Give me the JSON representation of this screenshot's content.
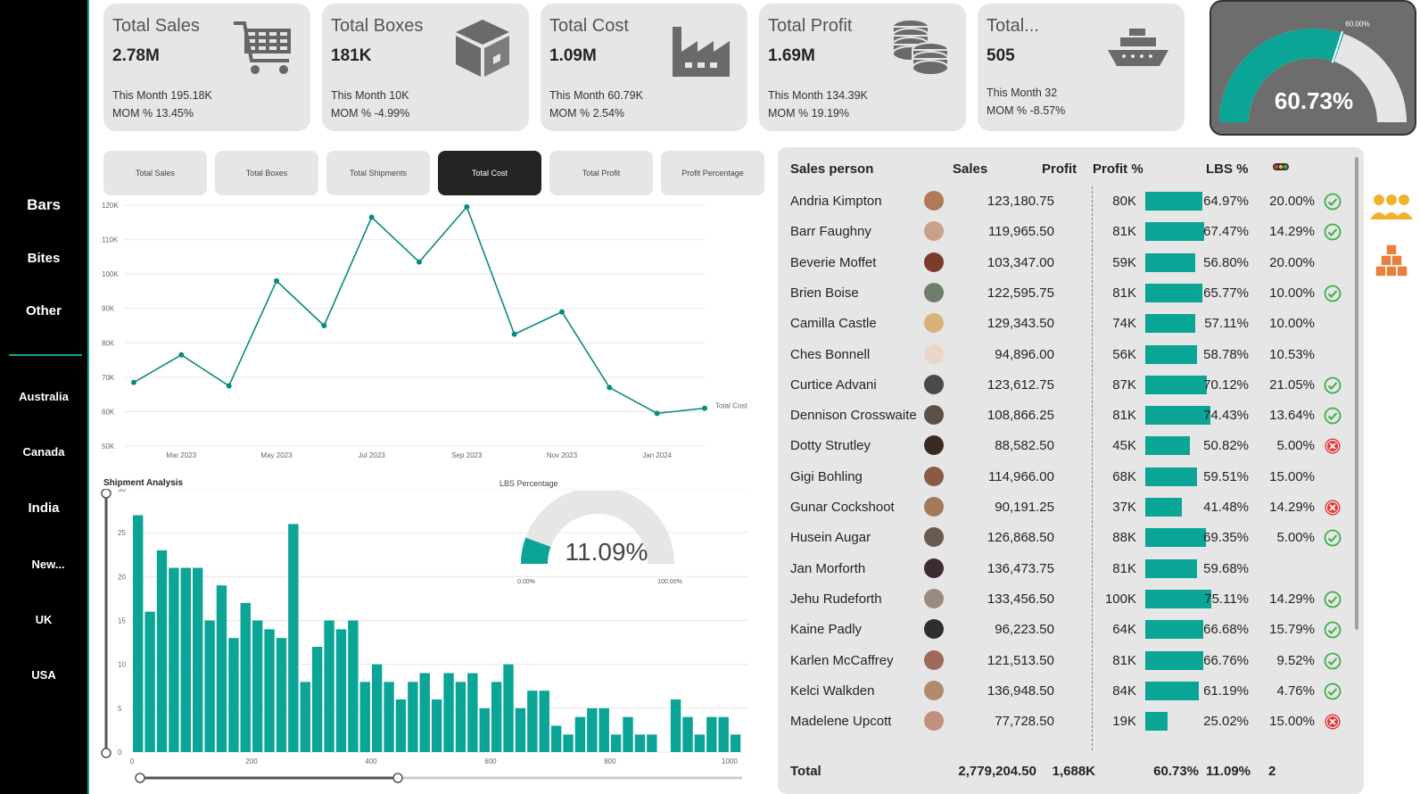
{
  "sidebar": {
    "categories": [
      "Bars",
      "Bites",
      "Other"
    ],
    "countries": [
      "Australia",
      "Canada",
      "India",
      "New...",
      "UK",
      "USA"
    ]
  },
  "cards": [
    {
      "title": "Total Sales",
      "value": "2.78M",
      "this_month": "This Month 195.18K",
      "mom": "MOM % 13.45%",
      "icon": "shopping-cart-icon"
    },
    {
      "title": "Total Boxes",
      "value": "181K",
      "this_month": "This Month 10K",
      "mom": "MOM % -4.99%",
      "icon": "box-icon"
    },
    {
      "title": "Total Cost",
      "value": "1.09M",
      "this_month": "This Month 60.79K",
      "mom": "MOM % 2.54%",
      "icon": "factory-icon"
    },
    {
      "title": "Total Profit",
      "value": "1.69M",
      "this_month": "This Month 134.39K",
      "mom": "MOM % 19.19%",
      "icon": "coins-icon"
    },
    {
      "title": "Total...",
      "value": "505",
      "this_month": "This Month 32",
      "mom": "MOM % -8.57%",
      "icon": "ship-icon"
    }
  ],
  "profit_gauge": {
    "value": "60.73%",
    "fraction": 0.6073,
    "target_label": "60.00%",
    "target": 0.6
  },
  "tabs": [
    "Total Sales",
    "Total Boxes",
    "Total Shipments",
    "Total Cost",
    "Total Profit",
    "Profit Percentage"
  ],
  "active_tab": 3,
  "colors": {
    "accent": "#0aa596",
    "dark": "#252423",
    "card": "#e6e6e6",
    "positive": "#3fae49",
    "negative": "#e0393e",
    "people": "#f2b12c",
    "boxes": "#e8803b"
  },
  "chart_data": [
    {
      "type": "line",
      "x": [
        "Feb 2023",
        "Mar 2023",
        "Apr 2023",
        "May 2023",
        "Jun 2023",
        "Jul 2023",
        "Aug 2023",
        "Sep 2023",
        "Oct 2023",
        "Nov 2023",
        "Dec 2023",
        "Jan 2024",
        "Feb 2024"
      ],
      "x_tick_labels": [
        "Mar 2023",
        "May 2023",
        "Jul 2023",
        "Sep 2023",
        "Nov 2023",
        "Jan 2024"
      ],
      "series": [
        {
          "name": "Total Cost",
          "values": [
            68500,
            76500,
            67500,
            98000,
            85000,
            116500,
            103500,
            119500,
            82500,
            89000,
            67000,
            59500,
            61000
          ]
        }
      ],
      "y_ticks": [
        "50K",
        "60K",
        "70K",
        "80K",
        "90K",
        "100K",
        "110K",
        "120K"
      ],
      "ylim": [
        50000,
        120000
      ],
      "grid": true
    },
    {
      "type": "bar",
      "title": "Shipment Analysis",
      "x_ticks": [
        "0",
        "200",
        "400",
        "600",
        "800",
        "1000"
      ],
      "y_ticks": [
        "0",
        "5",
        "10",
        "15",
        "20",
        "25",
        "30"
      ],
      "xlim": [
        0,
        1030
      ],
      "ylim": [
        0,
        30
      ],
      "bin_width": 20,
      "values": [
        27,
        16,
        23,
        21,
        21,
        21,
        15,
        19,
        13,
        17,
        15,
        14,
        13,
        26,
        8,
        12,
        15,
        14,
        15,
        8,
        10,
        8,
        6,
        8,
        9,
        6,
        9,
        8,
        9,
        5,
        8,
        10,
        5,
        7,
        7,
        3,
        2,
        4,
        5,
        5,
        2,
        4,
        2,
        2,
        0,
        6,
        4,
        2,
        4,
        4,
        2
      ]
    },
    {
      "type": "gauge",
      "title": "LBS Percentage",
      "value": 0.1109,
      "value_label": "11.09%",
      "min_label": "0.00%",
      "max_label": "100.00%"
    }
  ],
  "table": {
    "headers": [
      "Sales person",
      "Sales",
      "Profit",
      "Profit %",
      "LBS %"
    ],
    "rows": [
      {
        "name": "Andria Kimpton",
        "sales": "123,180.75",
        "profit": "80K",
        "ppct": "64.97%",
        "pv": 64.97,
        "lbs": "20.00%",
        "status": "check",
        "avatar": "#b07a58"
      },
      {
        "name": "Barr Faughny",
        "sales": "119,965.50",
        "profit": "81K",
        "ppct": "67.47%",
        "pv": 67.47,
        "lbs": "14.29%",
        "status": "check",
        "avatar": "#c9a08a"
      },
      {
        "name": "Beverie Moffet",
        "sales": "103,347.00",
        "profit": "59K",
        "ppct": "56.80%",
        "pv": 56.8,
        "lbs": "20.00%",
        "status": "",
        "avatar": "#7a3d2a"
      },
      {
        "name": "Brien Boise",
        "sales": "122,595.75",
        "profit": "81K",
        "ppct": "65.77%",
        "pv": 65.77,
        "lbs": "10.00%",
        "status": "check",
        "avatar": "#6e7e6a"
      },
      {
        "name": "Camilla Castle",
        "sales": "129,343.50",
        "profit": "74K",
        "ppct": "57.11%",
        "pv": 57.11,
        "lbs": "10.00%",
        "status": "",
        "avatar": "#d9b27a"
      },
      {
        "name": "Ches Bonnell",
        "sales": "94,896.00",
        "profit": "56K",
        "ppct": "58.78%",
        "pv": 58.78,
        "lbs": "10.53%",
        "status": "",
        "avatar": "#e9d6c8"
      },
      {
        "name": "Curtice Advani",
        "sales": "123,612.75",
        "profit": "87K",
        "ppct": "70.12%",
        "pv": 70.12,
        "lbs": "21.05%",
        "status": "check",
        "avatar": "#4a4a4a"
      },
      {
        "name": "Dennison Crosswaite",
        "sales": "108,866.25",
        "profit": "81K",
        "ppct": "74.43%",
        "pv": 74.43,
        "lbs": "13.64%",
        "status": "check",
        "avatar": "#5d5047"
      },
      {
        "name": "Dotty Strutley",
        "sales": "88,582.50",
        "profit": "45K",
        "ppct": "50.82%",
        "pv": 50.82,
        "lbs": "5.00%",
        "status": "cross",
        "avatar": "#3b2a24"
      },
      {
        "name": "Gigi Bohling",
        "sales": "114,966.00",
        "profit": "68K",
        "ppct": "59.51%",
        "pv": 59.51,
        "lbs": "15.00%",
        "status": "",
        "avatar": "#8a5a44"
      },
      {
        "name": "Gunar Cockshoot",
        "sales": "90,191.25",
        "profit": "37K",
        "ppct": "41.48%",
        "pv": 41.48,
        "lbs": "14.29%",
        "status": "cross",
        "avatar": "#a07a5a"
      },
      {
        "name": "Husein Augar",
        "sales": "126,868.50",
        "profit": "88K",
        "ppct": "69.35%",
        "pv": 69.35,
        "lbs": "5.00%",
        "status": "check",
        "avatar": "#6a5a50"
      },
      {
        "name": "Jan Morforth",
        "sales": "136,473.75",
        "profit": "81K",
        "ppct": "59.68%",
        "pv": 59.68,
        "lbs": "",
        "status": "",
        "avatar": "#3d2b33"
      },
      {
        "name": "Jehu Rudeforth",
        "sales": "133,456.50",
        "profit": "100K",
        "ppct": "75.11%",
        "pv": 75.11,
        "lbs": "14.29%",
        "status": "check",
        "avatar": "#9a8a80"
      },
      {
        "name": "Kaine Padly",
        "sales": "96,223.50",
        "profit": "64K",
        "ppct": "66.68%",
        "pv": 66.68,
        "lbs": "15.79%",
        "status": "check",
        "avatar": "#2e2e2e"
      },
      {
        "name": "Karlen McCaffrey",
        "sales": "121,513.50",
        "profit": "81K",
        "ppct": "66.76%",
        "pv": 66.76,
        "lbs": "9.52%",
        "status": "check",
        "avatar": "#a0685a"
      },
      {
        "name": "Kelci Walkden",
        "sales": "136,948.50",
        "profit": "84K",
        "ppct": "61.19%",
        "pv": 61.19,
        "lbs": "4.76%",
        "status": "check",
        "avatar": "#b08a6a"
      },
      {
        "name": "Madelene Upcott",
        "sales": "77,728.50",
        "profit": "19K",
        "ppct": "25.02%",
        "pv": 25.02,
        "lbs": "15.00%",
        "status": "cross",
        "avatar": "#c09080"
      }
    ],
    "total": {
      "label": "Total",
      "sales": "2,779,204.50",
      "profit": "1,688K",
      "ppct": "60.73%",
      "lbs": "11.09%",
      "status_count": "2"
    }
  }
}
